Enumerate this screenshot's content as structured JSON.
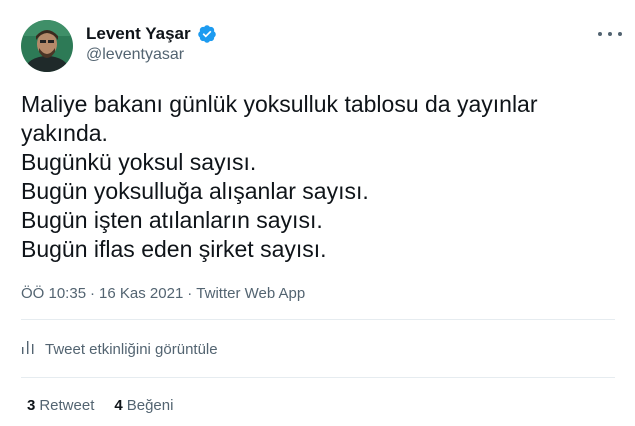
{
  "user": {
    "display_name": "Levent Yaşar",
    "handle": "@leventyasar",
    "verified": true,
    "verified_color": "#1d9bf0"
  },
  "tweet": {
    "lines": [
      "Maliye bakanı günlük yoksulluk tablosu da yayınlar",
      "yakında.",
      "Bugünkü yoksul sayısı.",
      "Bugün yoksulluğa alışanlar sayısı.",
      "Bugün işten atılanların sayısı.",
      "Bugün iflas eden şirket sayısı."
    ]
  },
  "meta": {
    "time": "ÖÖ 10:35",
    "separator": "·",
    "date": "16 Kas 2021",
    "source": "Twitter Web App"
  },
  "analytics": {
    "label": "Tweet etkinliğini görüntüle",
    "icon": "analytics-icon"
  },
  "stats": {
    "retweets_count": "3",
    "retweets_label": "Retweet",
    "likes_count": "4",
    "likes_label": "Beğeni"
  },
  "more_icon": "more-icon",
  "colors": {
    "text": "#0f1419",
    "secondary": "#536471",
    "divider": "#e6ecf0"
  }
}
